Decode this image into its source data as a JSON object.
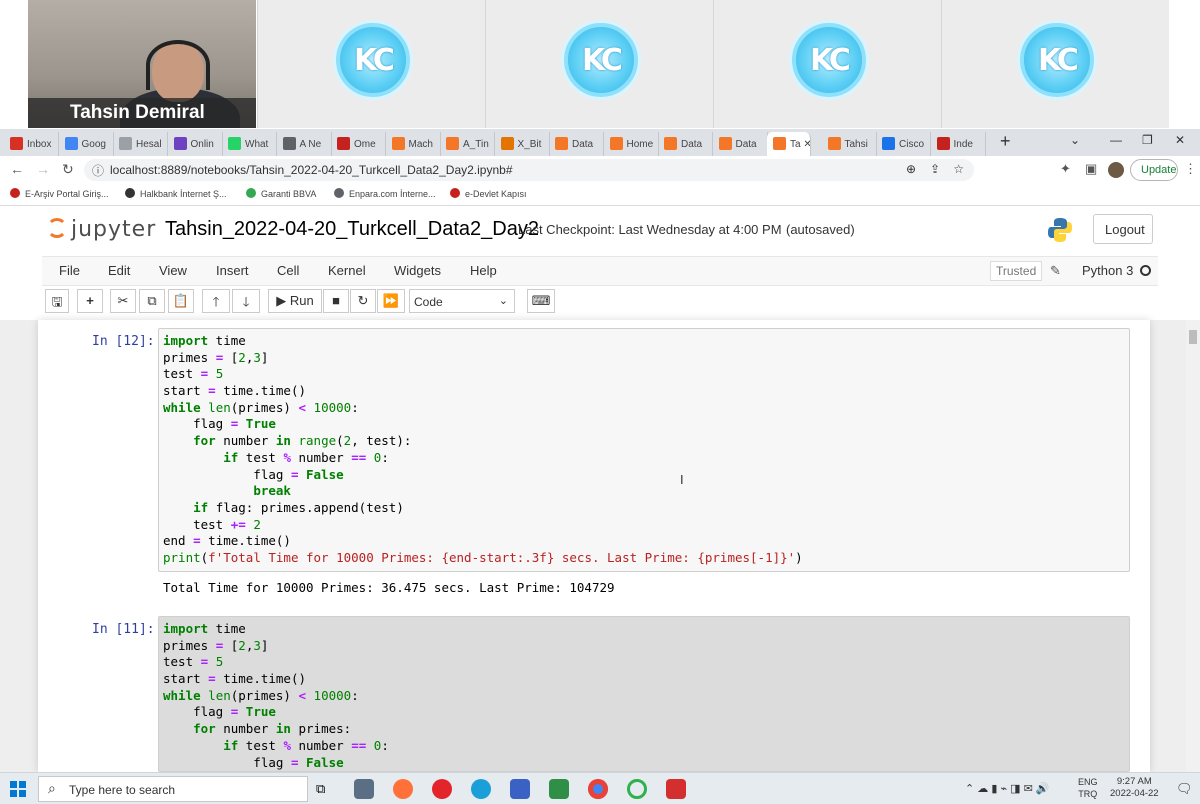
{
  "call": {
    "presenter_name": "Tahsin Demiral",
    "logo_text": "KC",
    "participant_count": 4
  },
  "browser": {
    "tabs": [
      {
        "label": "Inbox",
        "icon": "gmail-icon",
        "color": "#d93025"
      },
      {
        "label": "Goog",
        "icon": "google-sites-icon",
        "color": "#4285f4"
      },
      {
        "label": "Hesal",
        "icon": "doc-icon",
        "color": "#9aa0a6"
      },
      {
        "label": "Onlin",
        "icon": "online-icon",
        "color": "#6f42c1"
      },
      {
        "label": "What",
        "icon": "whatsapp-icon",
        "color": "#25d366"
      },
      {
        "label": "A Ne",
        "icon": "page-icon",
        "color": "#5f6368"
      },
      {
        "label": "Ome",
        "icon": "omega-icon",
        "color": "#c5221f"
      },
      {
        "label": "Mach",
        "icon": "jupyter-tab-icon",
        "color": "#f37726"
      },
      {
        "label": "A_Tin",
        "icon": "jupyter-tab-icon",
        "color": "#f37726"
      },
      {
        "label": "X_Bit",
        "icon": "x-icon",
        "color": "#e37400"
      },
      {
        "label": "Data",
        "icon": "jupyter-tab-icon",
        "color": "#f37726"
      },
      {
        "label": "Home",
        "icon": "home-icon",
        "color": "#f37726"
      },
      {
        "label": "Data",
        "icon": "jupyter-tab-icon",
        "color": "#f37726"
      },
      {
        "label": "Data",
        "icon": "jupyter-tab-icon",
        "color": "#f37726"
      },
      {
        "label": "Ta",
        "icon": "jupyter-tab-icon",
        "color": "#f37726",
        "active": true
      },
      {
        "label": "Tahsi",
        "icon": "jupyter-tab-icon",
        "color": "#f37726"
      },
      {
        "label": "Cisco",
        "icon": "cisco-icon",
        "color": "#1a73e8"
      },
      {
        "label": "Inde",
        "icon": "omega-icon",
        "color": "#c5221f"
      }
    ],
    "url": "localhost:8889/notebooks/Tahsin_2022-04-20_Turkcell_Data2_Day2.ipynb#",
    "update_label": "Update",
    "bookmarks": [
      {
        "label": "E-Arşiv Portal Giriş...",
        "color": "#c5221f"
      },
      {
        "label": "Halkbank İnternet Ş...",
        "color": "#333333"
      },
      {
        "label": "Garanti BBVA",
        "color": "#34a853"
      },
      {
        "label": "Enpara.com İnterne...",
        "color": "#5f6368"
      },
      {
        "label": "e-Devlet Kapısı",
        "color": "#c5221f"
      }
    ]
  },
  "jupyter": {
    "logo_text": "jupyter",
    "notebook_title": "Tahsin_2022-04-20_Turkcell_Data2_Day2",
    "checkpoint": "Last Checkpoint: Last Wednesday at 4:00 PM",
    "autosaved": "(autosaved)",
    "logout": "Logout",
    "menu": [
      "File",
      "Edit",
      "View",
      "Insert",
      "Cell",
      "Kernel",
      "Widgets",
      "Help"
    ],
    "trusted": "Trusted",
    "kernel": "Python 3",
    "run_label": "Run",
    "cell_type": "Code"
  },
  "cells": [
    {
      "prompt": "In [12]:",
      "lines": [
        "import time",
        "primes = [2,3]",
        "test = 5",
        "start = time.time()",
        "while len(primes) < 10000:",
        "    flag = True",
        "    for number in range(2, test):",
        "        if test % number == 0:",
        "            flag = False",
        "            break",
        "    if flag: primes.append(test)",
        "    test += 2",
        "end = time.time()",
        "print(f'Total Time for 10000 Primes: {end-start:.3f} secs. Last Prime: {primes[-1]}')"
      ],
      "output": "Total Time for 10000 Primes: 36.475 secs. Last Prime: 104729"
    },
    {
      "prompt": "In [11]:",
      "lines": [
        "import time",
        "primes = [2,3]",
        "test = 5",
        "start = time.time()",
        "while len(primes) < 10000:",
        "    flag = True",
        "    for number in primes:",
        "        if test % number == 0:",
        "            flag = False"
      ],
      "output": ""
    }
  ],
  "taskbar": {
    "search_placeholder": "Type here to search",
    "lang_top": "ENG",
    "lang_bottom": "TRQ",
    "time": "9:27 AM",
    "date": "2022-04-22"
  }
}
